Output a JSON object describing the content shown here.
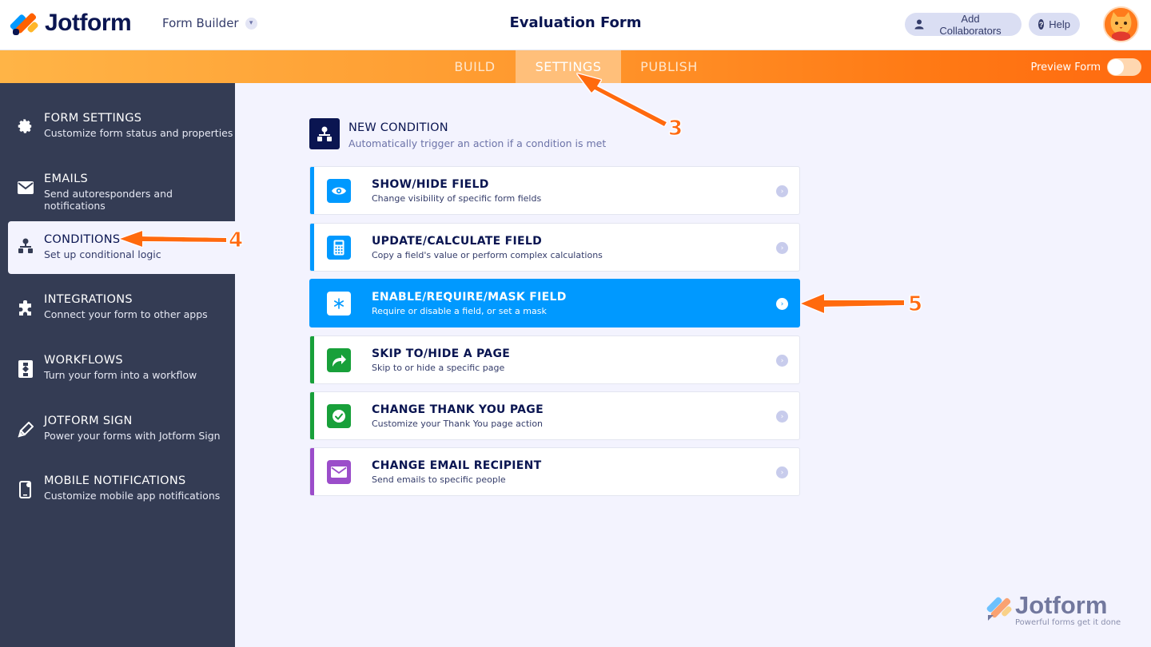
{
  "header": {
    "brand": "Jotform",
    "builder_label": "Form Builder",
    "form_title": "Evaluation Form",
    "add_collaborators": "Add Collaborators",
    "help": "Help"
  },
  "nav": {
    "tabs": [
      {
        "label": "BUILD"
      },
      {
        "label": "SETTINGS",
        "active": true
      },
      {
        "label": "PUBLISH"
      }
    ],
    "preview_label": "Preview Form",
    "preview_on": false
  },
  "sidebar": {
    "items": [
      {
        "title": "FORM SETTINGS",
        "subtitle": "Customize form status and properties",
        "icon": "gear-icon"
      },
      {
        "title": "EMAILS",
        "subtitle": "Send autoresponders and notifications",
        "icon": "envelope-icon"
      },
      {
        "title": "CONDITIONS",
        "subtitle": "Set up conditional logic",
        "icon": "conditions-icon",
        "active": true
      },
      {
        "title": "INTEGRATIONS",
        "subtitle": "Connect your form to other apps",
        "icon": "puzzle-icon"
      },
      {
        "title": "WORKFLOWS",
        "subtitle": "Turn your form into a workflow",
        "icon": "workflow-icon"
      },
      {
        "title": "JOTFORM SIGN",
        "subtitle": "Power your forms with Jotform Sign",
        "icon": "pen-icon"
      },
      {
        "title": "MOBILE NOTIFICATIONS",
        "subtitle": "Customize mobile app notifications",
        "icon": "mobile-icon"
      }
    ]
  },
  "main": {
    "new_condition_title": "NEW CONDITION",
    "new_condition_subtitle": "Automatically trigger an action if a condition is met",
    "cards": [
      {
        "title": "SHOW/HIDE FIELD",
        "subtitle": "Change visibility of specific form fields",
        "icon": "eye-icon",
        "color": "#0099ff"
      },
      {
        "title": "UPDATE/CALCULATE FIELD",
        "subtitle": "Copy a field's value or perform complex calculations",
        "icon": "calculator-icon",
        "color": "#0099ff"
      },
      {
        "title": "ENABLE/REQUIRE/MASK FIELD",
        "subtitle": "Require or disable a field, or set a mask",
        "icon": "asterisk-icon",
        "color": "#0099ff",
        "active": true
      },
      {
        "title": "SKIP TO/HIDE A PAGE",
        "subtitle": "Skip to or hide a specific page",
        "icon": "redirect-arrow-icon",
        "color": "#18a03a"
      },
      {
        "title": "CHANGE THANK YOU PAGE",
        "subtitle": "Customize your Thank You page action",
        "icon": "check-icon",
        "color": "#18a03a"
      },
      {
        "title": "CHANGE EMAIL RECIPIENT",
        "subtitle": "Send emails to specific people",
        "icon": "envelope-icon",
        "color": "#9b4dca"
      }
    ]
  },
  "annotations": {
    "step3": "3",
    "step4": "4",
    "step5": "5",
    "color": "#ff6a10"
  },
  "watermark": {
    "brand": "Jotform",
    "tagline": "Powerful forms get it done"
  }
}
